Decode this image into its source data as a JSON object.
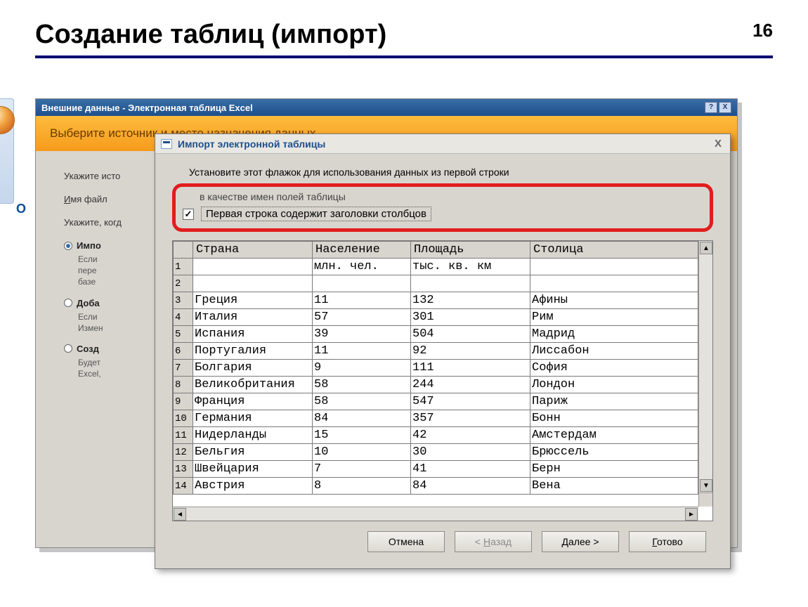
{
  "slide": {
    "title": "Создание таблиц (импорт)",
    "number": "16"
  },
  "outer": {
    "title": "Внешние данные - Электронная таблица Excel",
    "orange": "Выберите источник и место назначения данных",
    "specify_src": "Укажите исто",
    "filename_label": "Имя файл",
    "specify_where_when": "Укажите, когд",
    "opt_import": "Импо",
    "opt_import_sub1": "Если",
    "opt_import_sub2": "пере",
    "opt_import_sub3": "базе",
    "opt_append": "Доба",
    "opt_append_sub1": "Если",
    "opt_append_sub2": "Измен",
    "opt_link": "Созд",
    "opt_link_sub1": "Будет",
    "opt_link_sub2": "Excel,"
  },
  "wizard": {
    "title": "Импорт электронной таблицы",
    "instr": "Установите этот флажок для использования данных из первой строки",
    "instr2": "в качестве имен полей таблицы",
    "checkbox_label": "Первая строка содержит заголовки столбцов",
    "columns": [
      "Страна",
      "Население",
      "Площадь",
      "Столица"
    ],
    "unit_row": [
      "",
      "млн. чел.",
      "тыс. кв. км",
      ""
    ],
    "rows": [
      [
        "Греция",
        "11",
        "132",
        "Афины"
      ],
      [
        "Италия",
        "57",
        "301",
        "Рим"
      ],
      [
        "Испания",
        "39",
        "504",
        "Мадрид"
      ],
      [
        "Португалия",
        "11",
        "92",
        "Лиссабон"
      ],
      [
        "Болгария",
        "9",
        "111",
        "София"
      ],
      [
        "Великобритания",
        "58",
        "244",
        "Лондон"
      ],
      [
        "Франция",
        "58",
        "547",
        "Париж"
      ],
      [
        "Германия",
        "84",
        "357",
        "Бонн"
      ],
      [
        "Нидерланды",
        "15",
        "42",
        "Амстердам"
      ],
      [
        "Бельгия",
        "10",
        "30",
        "Брюссель"
      ],
      [
        "Швейцария",
        "7",
        "41",
        "Берн"
      ],
      [
        "Австрия",
        "8",
        "84",
        "Вена"
      ]
    ],
    "buttons": {
      "cancel": "Отмена",
      "back": "< Назад",
      "next": "Далее >",
      "finish": "Готово"
    }
  },
  "glyphs": {
    "help": "?",
    "close": "X",
    "check": "✓",
    "up": "▲",
    "down": "▼",
    "left": "◄",
    "right": "►"
  }
}
